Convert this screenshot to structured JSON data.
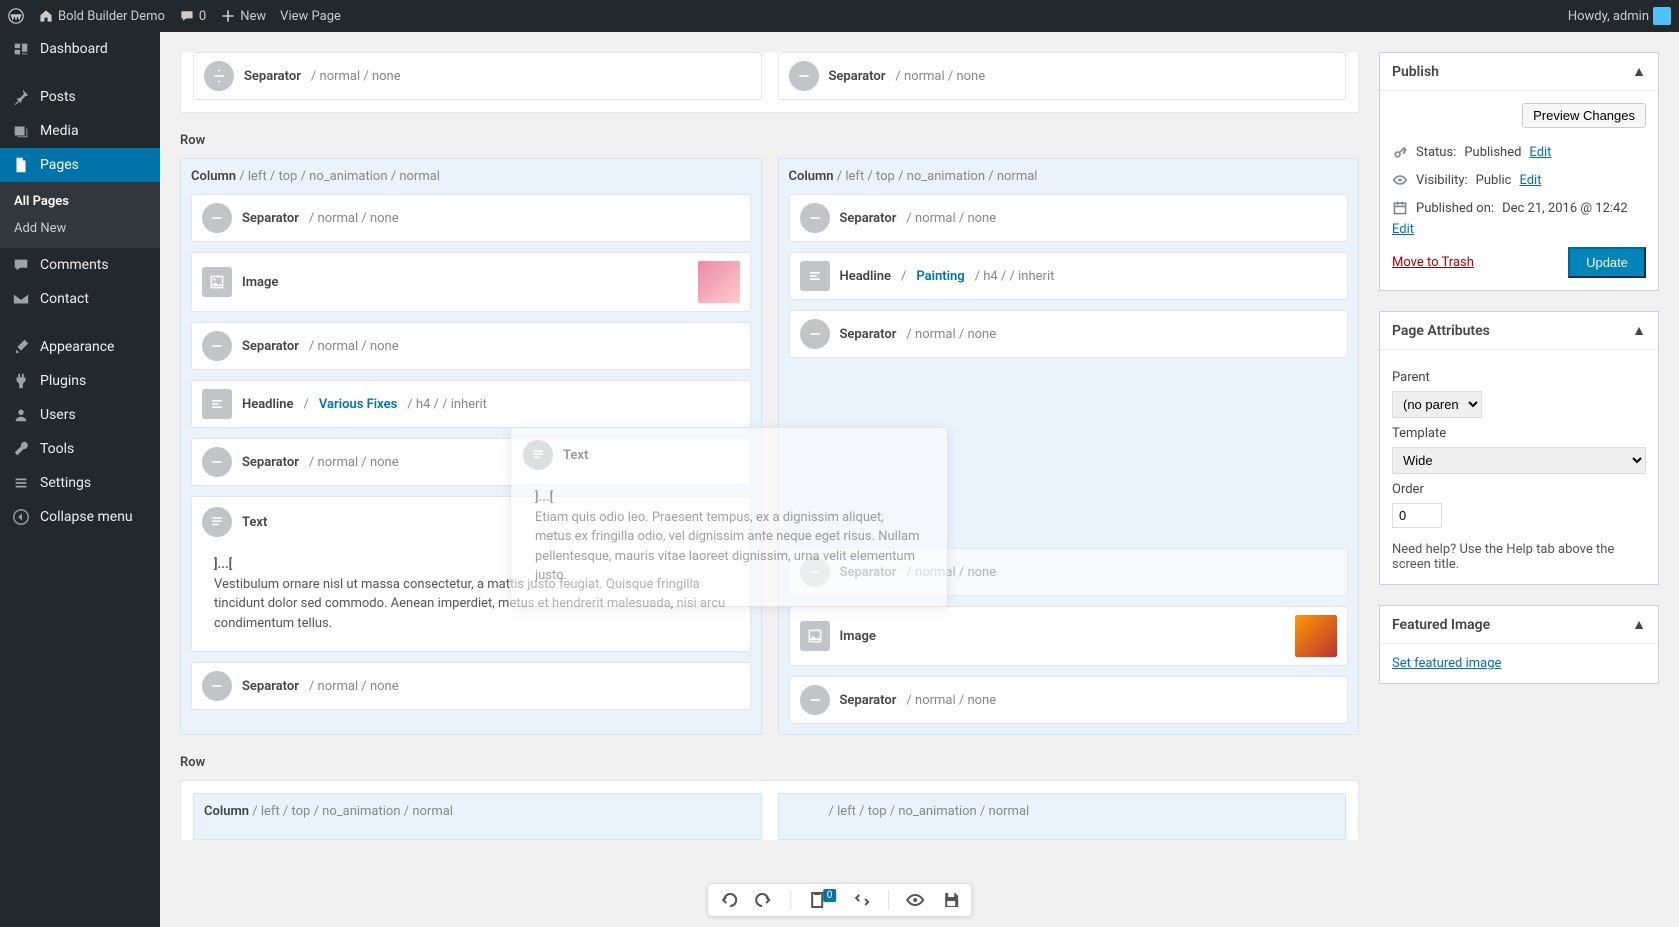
{
  "topbar": {
    "site": "Bold Builder Demo",
    "comments": "0",
    "new": "New",
    "view": "View Page",
    "greeting": "Howdy, admin"
  },
  "sidebar": {
    "items": [
      {
        "label": "Dashboard"
      },
      {
        "label": "Posts"
      },
      {
        "label": "Media"
      },
      {
        "label": "Pages"
      },
      {
        "label": "Comments"
      },
      {
        "label": "Contact"
      },
      {
        "label": "Appearance"
      },
      {
        "label": "Plugins"
      },
      {
        "label": "Users"
      },
      {
        "label": "Tools"
      },
      {
        "label": "Settings"
      },
      {
        "label": "Collapse menu"
      }
    ],
    "sub": {
      "allPages": "All Pages",
      "addNew": "Add New"
    }
  },
  "publish": {
    "title": "Publish",
    "preview": "Preview Changes",
    "statusLabel": "Status:",
    "statusVal": "Published",
    "edit": "Edit",
    "visLabel": "Visibility:",
    "visVal": "Public",
    "pubLabel": "Published on:",
    "pubVal": "Dec 21, 2016 @ 12:42",
    "trash": "Move to Trash",
    "update": "Update"
  },
  "attrs": {
    "title": "Page Attributes",
    "parentLabel": "Parent",
    "parentVal": "(no parent)",
    "templateLabel": "Template",
    "templateVal": "Wide",
    "orderLabel": "Order",
    "orderVal": "0",
    "help": "Need help? Use the Help tab above the screen title."
  },
  "featured": {
    "title": "Featured Image",
    "link": "Set featured image"
  },
  "builder": {
    "row": "Row",
    "colHeader": "Column",
    "colMeta": "/  left  /  top  /  no_animation  /  normal",
    "separator": "Separator",
    "sepMeta": "/  normal  /  none",
    "image": "Image",
    "headline": "Headline",
    "hl1Link": "Various Fixes",
    "hl1Meta": "/  h4  /   /  inherit",
    "hl2Link": "Painting",
    "hl2Meta": "/  h4  /   /  inherit",
    "text": "Text",
    "dots": "]...[",
    "textBody1": "Vestibulum ornare nisl ut massa consectetur, a mattis justo feugiat. Quisque fringilla tincidunt dolor sed commodo. Aenean imperdiet, metus et hendrerit malesuada, nisi arcu condimentum tellus.",
    "textBody2": "Etiam quis odio leo. Praesent tempus, ex a dignissim aliquet, metus ex fringilla odio, vel dignissim ante neque eget risus. Nullam pellentesque, mauris vitae laoreet dignissim, urna velit elementum justo."
  },
  "bottombar": {
    "clipboardCount": "0"
  }
}
